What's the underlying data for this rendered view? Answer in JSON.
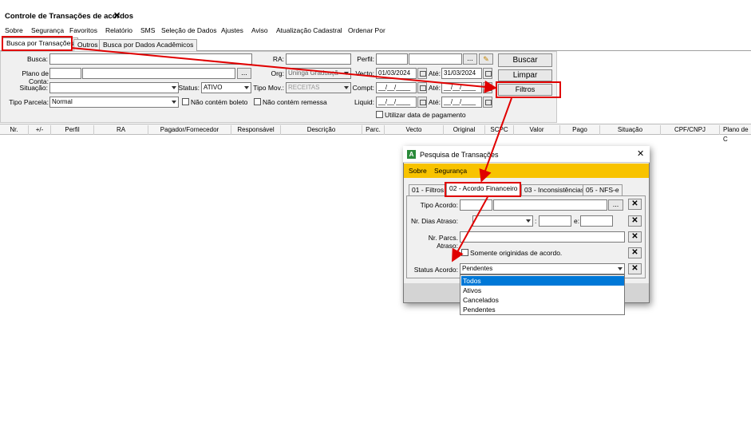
{
  "window": {
    "title": "Controle de Transações de acordos",
    "close": "✕"
  },
  "menu": [
    "Sobre",
    "Segurança",
    "Favoritos",
    "Relatório",
    "SMS",
    "Seleção de Dados",
    "Ajustes",
    "Aviso",
    "Atualização Cadastral",
    "Ordenar Por"
  ],
  "tabs": [
    "Busca por Transações",
    "Outros",
    "Busca por Dados Acadêmicos"
  ],
  "form": {
    "busca_label": "Busca:",
    "ra_label": "RA:",
    "perfil_label": "Perfil:",
    "plano_label": "Plano de Conta:",
    "org_label": "Org:",
    "org_value": "Uninga Graduaçã",
    "vecto_label": "Vecto:",
    "vecto_from": "01/03/2024",
    "ate_label": "Até:",
    "vecto_to": "31/03/2024",
    "situacao_label": "Situação:",
    "status_label": "Status:",
    "status_value": "ATIVO",
    "tipomov_label": "Tipo Mov.:",
    "tipomov_value": "RECEITAS",
    "compt_label": "Compt:",
    "compt_value": "__/__/____",
    "ate2_label": "Até:",
    "ate2_value": "__/__/____",
    "tipoparcela_label": "Tipo Parcela:",
    "tipoparcela_value": "Normal",
    "nao_boleto": "Não contém boleto",
    "nao_remessa": "Não contém remessa",
    "liquid_label": "Liquid:",
    "liquid_value": "__/__/____",
    "ate3_label": "Até:",
    "ate3_value": "__/__/____",
    "utilizar_data": "Utilizar data de pagamento",
    "ellipsis": "...",
    "btn_buscar": "Buscar",
    "btn_limpar": "Limpar",
    "btn_filtros": "Filtros"
  },
  "grid_columns": [
    "Nr.",
    "+/-",
    "Perfil",
    "RA",
    "Pagador/Fornecedor",
    "Responsável",
    "Descrição",
    "Parc.",
    "Vecto",
    "Original",
    "SCPC",
    "Valor",
    "Pago",
    "Situação",
    "CPF/CNPJ",
    "Plano de C"
  ],
  "dialog": {
    "title": "Pesquisa de Transações",
    "close": "✕",
    "menu": [
      "Sobre",
      "Segurança"
    ],
    "tabs": [
      "01 - Filtros",
      "02 - Acordo Financeiro",
      "03 - Inconsistências",
      "05 - NFS-e"
    ],
    "tipo_acordo_label": "Tipo Acordo:",
    "nr_dias_label": "Nr. Dias Atraso:",
    "e_label": "e:",
    "colon": ":",
    "nr_parcs_label": "Nr. Parcs. Atraso:",
    "somente_label": "Somente originidas de acordo.",
    "status_acordo_label": "Status Acordo:",
    "status_acordo_value": "Pendentes",
    "ellipsis": "...",
    "options": [
      "Todos",
      "Ativos",
      "Cancelados",
      "Pendentes"
    ]
  },
  "colors": {
    "accent_yellow": "#f8c300",
    "highlight": "#0078d7",
    "annotation_red": "#e00000"
  }
}
